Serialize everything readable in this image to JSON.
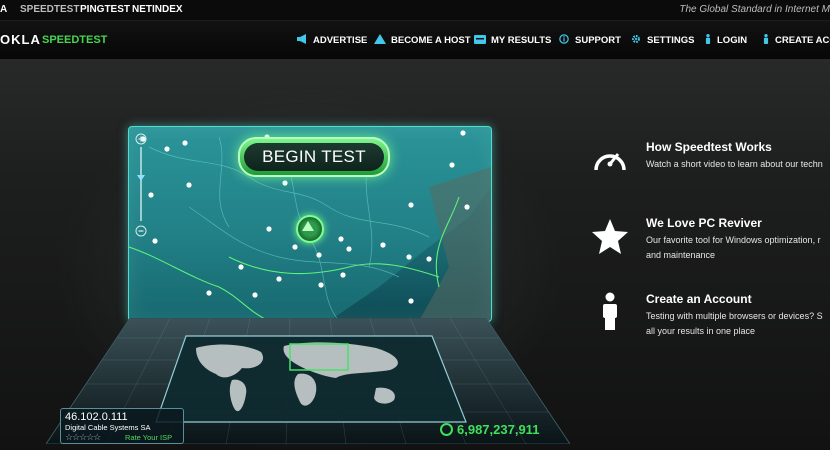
{
  "topbar": {
    "items": [
      "A",
      "SPEEDTEST",
      "PINGTEST",
      "NETINDEX"
    ],
    "tagline": "The Global Standard in Internet M"
  },
  "nav": {
    "logo": "OKLA",
    "brand": "SPEEDTEST",
    "items": [
      {
        "label": "ADVERTISE",
        "icon": "megaphone-icon"
      },
      {
        "label": "BECOME A HOST",
        "icon": "triangle-icon"
      },
      {
        "label": "MY RESULTS",
        "icon": "results-icon"
      },
      {
        "label": "SUPPORT",
        "icon": "info-icon"
      },
      {
        "label": "SETTINGS",
        "icon": "gear-icon"
      },
      {
        "label": "LOGIN",
        "icon": "person-icon"
      },
      {
        "label": "CREATE ACC",
        "icon": "person-icon"
      }
    ]
  },
  "test": {
    "begin_label": "BEGIN TEST",
    "ip": "46.102.0.111",
    "isp": "Digital Cable Systems SA",
    "stars": "☆☆☆☆☆",
    "rate_label": "Rate Your ISP",
    "counter": "6,987,237,911"
  },
  "features": [
    {
      "title": "How Speedtest Works",
      "desc": [
        "Watch a short video to learn about our techn"
      ],
      "icon": "gauge-icon"
    },
    {
      "title": "We Love PC Reviver",
      "desc": [
        "Our favorite tool for Windows optimization, r",
        "and maintenance"
      ],
      "icon": "star-icon"
    },
    {
      "title": "Create an Account",
      "desc": [
        "Testing with multiple browsers or devices? S",
        "all your results in one place"
      ],
      "icon": "person-icon"
    }
  ],
  "colors": {
    "accent_green": "#47d451",
    "map_teal": "#1d7078",
    "glow": "#4de0cf"
  }
}
